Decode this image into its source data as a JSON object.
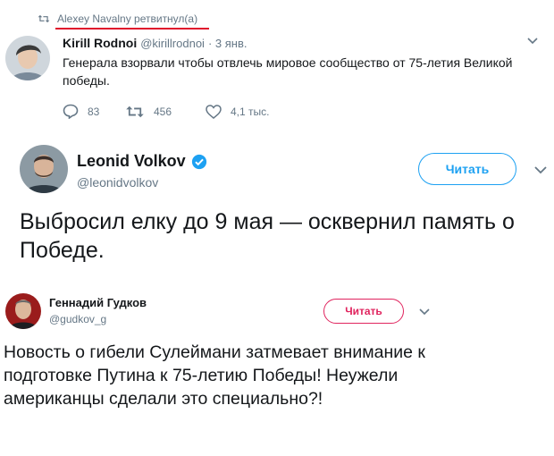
{
  "retweet": {
    "text": "Alexey Navalny ретвитнул(а)",
    "icon": "retweet-icon",
    "underline_color": "#e0102c"
  },
  "tweet1": {
    "author_name": "Kirill Rodnoi",
    "author_handle": "@kirillrodnoi",
    "date": "· 3 янв.",
    "text": "Генерала взорвали чтобы отвлечь мировое сообщество от  75-летия Великой победы.",
    "replies": "83",
    "retweets": "456",
    "likes": "4,1 тыс."
  },
  "tweet2": {
    "author_name": "Leonid Volkov",
    "author_handle": "@leonidvolkov",
    "follow_label": "Читать",
    "text": "Выбросил елку до 9 мая — осквернил память о Победе.",
    "accent": "#1da1f2"
  },
  "tweet3": {
    "author_name": "Геннадий Гудков",
    "author_handle": "@gudkov_g",
    "follow_label": "Читать",
    "text": "Новость о гибели Сулеймани затмевает внимание к подготовке Путина к 75-летию Победы! Неужели американцы сделали это специально?!",
    "accent": "#e0245e"
  }
}
